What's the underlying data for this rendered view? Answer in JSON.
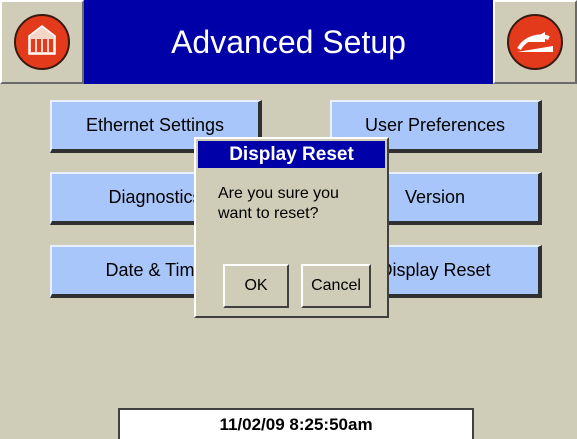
{
  "header": {
    "title": "Advanced Setup",
    "home_icon": "home-icon",
    "back_icon": "back-icon"
  },
  "menu": {
    "ethernet_settings": "Ethernet Settings",
    "user_preferences": "User Preferences",
    "diagnostics": "Diagnostics",
    "version": "Version",
    "date_time": "Date & Time",
    "display_reset": "Display Reset"
  },
  "dialog": {
    "title": "Display Reset",
    "message_line1": "Are you sure you",
    "message_line2": "want to reset?",
    "ok_label": "OK",
    "cancel_label": "Cancel"
  },
  "status": {
    "datetime": "11/02/09  8:25:50am"
  },
  "colors": {
    "background": "#cfcdb7",
    "title_bar": "#0000a8",
    "menu_button": "#a9c6fb",
    "icon_red": "#e23a1b"
  }
}
